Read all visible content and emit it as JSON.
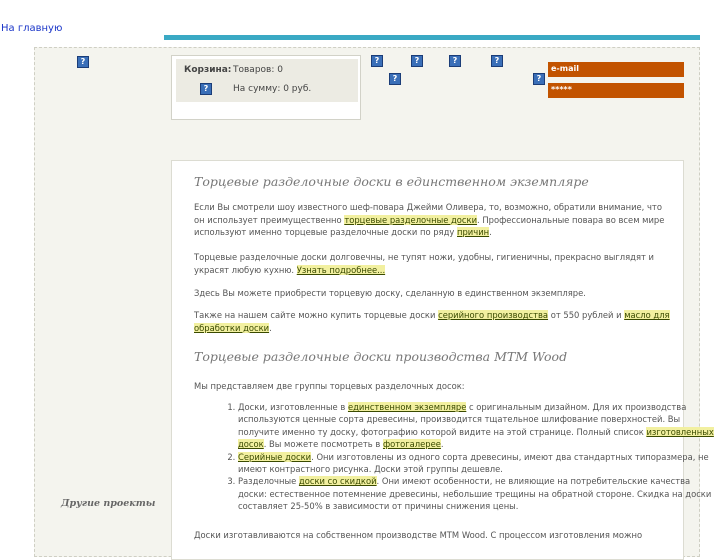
{
  "nav": {
    "home_label": "На главную"
  },
  "cart": {
    "label": "Корзина:",
    "goods": "Товаров: 0",
    "sum": "На сумму: 0 руб."
  },
  "login": {
    "email_label": "e-mail",
    "password_mask": "*****"
  },
  "icons": {
    "broken_image": "?"
  },
  "sidebar": {
    "other_projects": "Другие проекты"
  },
  "article": {
    "title1": "Торцевые разделочные доски в единственном экземпляре",
    "p1_a": "Если Вы смотрели шоу известного шеф-повара Джейми Оливера, то, возможно, обратили внимание, что он использует преимущественно ",
    "p1_link1": "торцевые разделочные доски",
    "p1_b": ". Профессиональные повара во всем мире используют именно торцевые разделочные доски по ряду ",
    "p1_link2": "причин",
    "p1_c": ".",
    "p2_a": "Торцевые разделочные доски долговечны, не тупят ножи, удобны, гигиеничны, прекрасно выглядят и украсят любую кухню. ",
    "p2_link": "Узнать подробнее...",
    "p3": "Здесь Вы можете приобрести торцевую доску, сделанную в единственном экземпляре.",
    "p4_a": "Также на нашем сайте можно купить торцевые доски ",
    "p4_link1": "серийного производства",
    "p4_b": " от 550 рублей и ",
    "p4_link2": "масло для обработки доски",
    "p4_c": ".",
    "title2": "Торцевые разделочные доски производства МТМ Wood",
    "p5": "Мы представляем две группы торцевых разделочных досок:",
    "li1_a": "Доски, изготовленные в ",
    "li1_link1": "единственном экземпляре",
    "li1_b": " с оригинальным дизайном. Для их производства используются ценные сорта древесины, производится тщательное шлифование поверхностей. Вы получите именно ту доску, фотографию которой видите на этой странице. Полный список ",
    "li1_link2": "изготовленных досок",
    "li1_c": ". Вы можете посмотреть в ",
    "li1_link3": "фотогалерее",
    "li1_d": ".",
    "li2_link": "Серийные доски",
    "li2_b": ". Они изготовлены из одного сорта древесины, имеют два стандартных типоразмера, не имеют контрастного рисунка. Доски этой группы дешевле.",
    "li3_a": "Разделочные ",
    "li3_link": "доски со скидкой",
    "li3_b": ". Они имеют особенности, не влияющие на потребительские качества доски: естественное потемнение древесины, небольшие трещины на обратной стороне. Скидка на доски составляет 25-50% в зависимости от причины снижения цены.",
    "p6": "Доски изготавливаются на собственном производстве МТМ Wood. С процессом изготовления можно"
  }
}
